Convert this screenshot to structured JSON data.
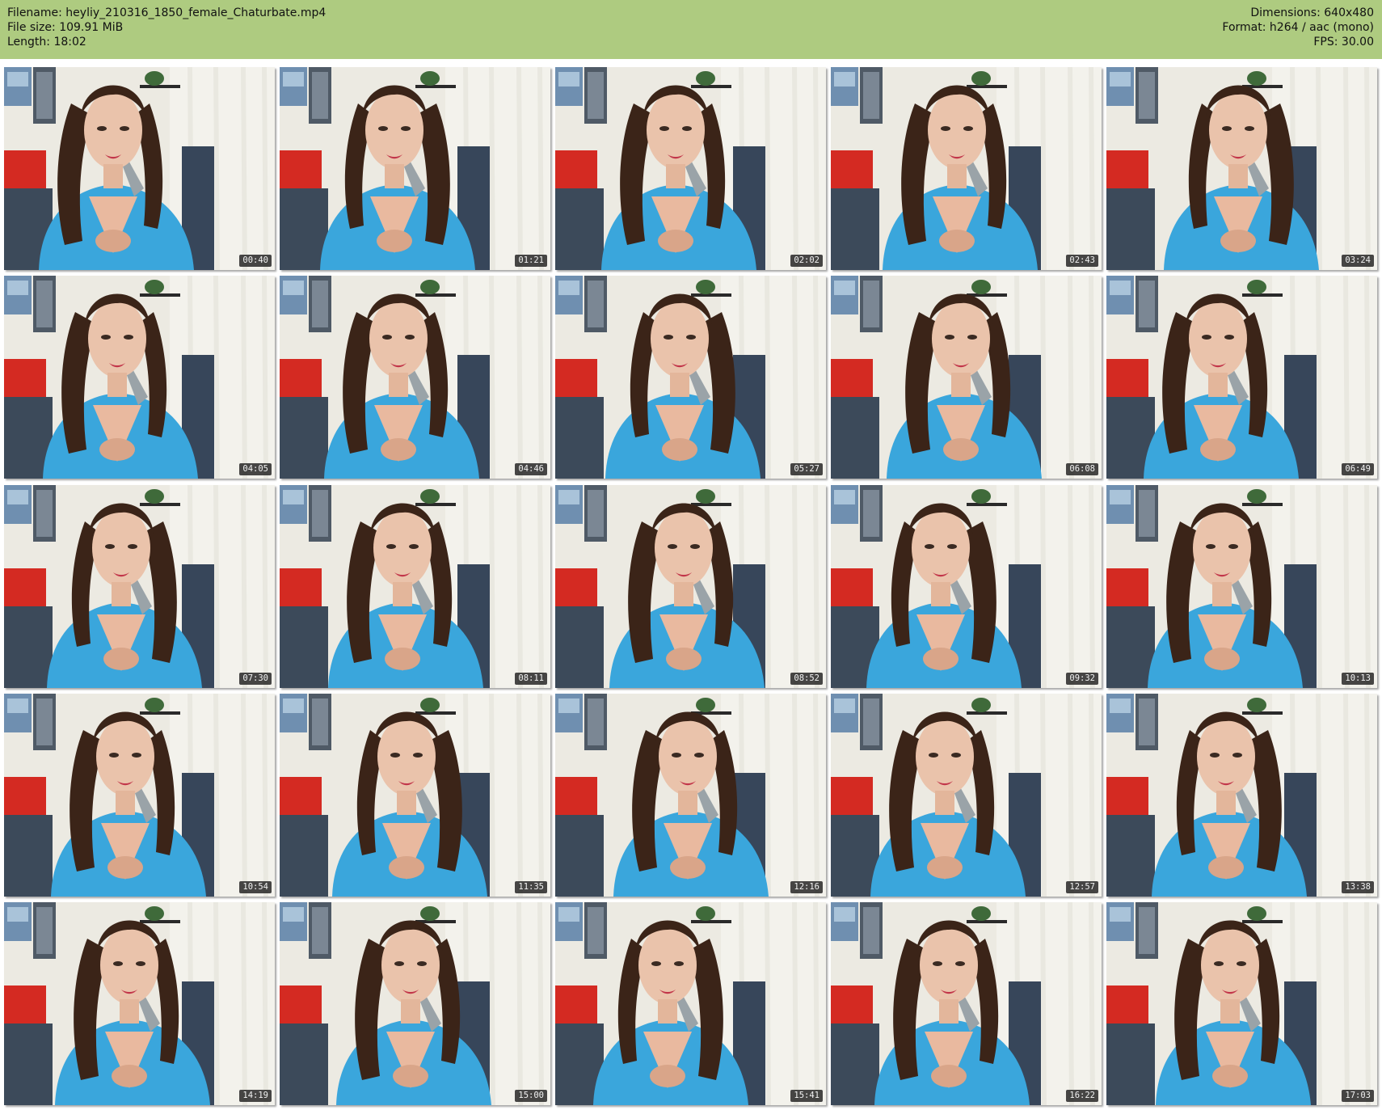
{
  "header": {
    "filename": "Filename: heyliy_210316_1850_female_Chaturbate.mp4",
    "filesize": "File size: 109.91 MiB",
    "length": "Length: 18:02",
    "dimensions": "Dimensions: 640x480",
    "format": "Format: h264 / aac (mono)",
    "fps": "FPS: 30.00"
  },
  "thumbnails": [
    {
      "time": "00:40"
    },
    {
      "time": "01:21"
    },
    {
      "time": "02:02"
    },
    {
      "time": "02:43"
    },
    {
      "time": "03:24"
    },
    {
      "time": "04:05"
    },
    {
      "time": "04:46"
    },
    {
      "time": "05:27"
    },
    {
      "time": "06:08"
    },
    {
      "time": "06:49"
    },
    {
      "time": "07:30"
    },
    {
      "time": "08:11"
    },
    {
      "time": "08:52"
    },
    {
      "time": "09:32"
    },
    {
      "time": "10:13"
    },
    {
      "time": "10:54"
    },
    {
      "time": "11:35"
    },
    {
      "time": "12:16"
    },
    {
      "time": "12:57"
    },
    {
      "time": "13:38"
    },
    {
      "time": "14:19"
    },
    {
      "time": "15:00"
    },
    {
      "time": "15:41"
    },
    {
      "time": "16:22"
    },
    {
      "time": "17:03"
    }
  ],
  "colors": {
    "header_bg": "#aecb80",
    "wall": "#eceae2",
    "shirt": "#3aa6dc",
    "hair": "#3b2418",
    "chair_red": "#d42a22"
  }
}
